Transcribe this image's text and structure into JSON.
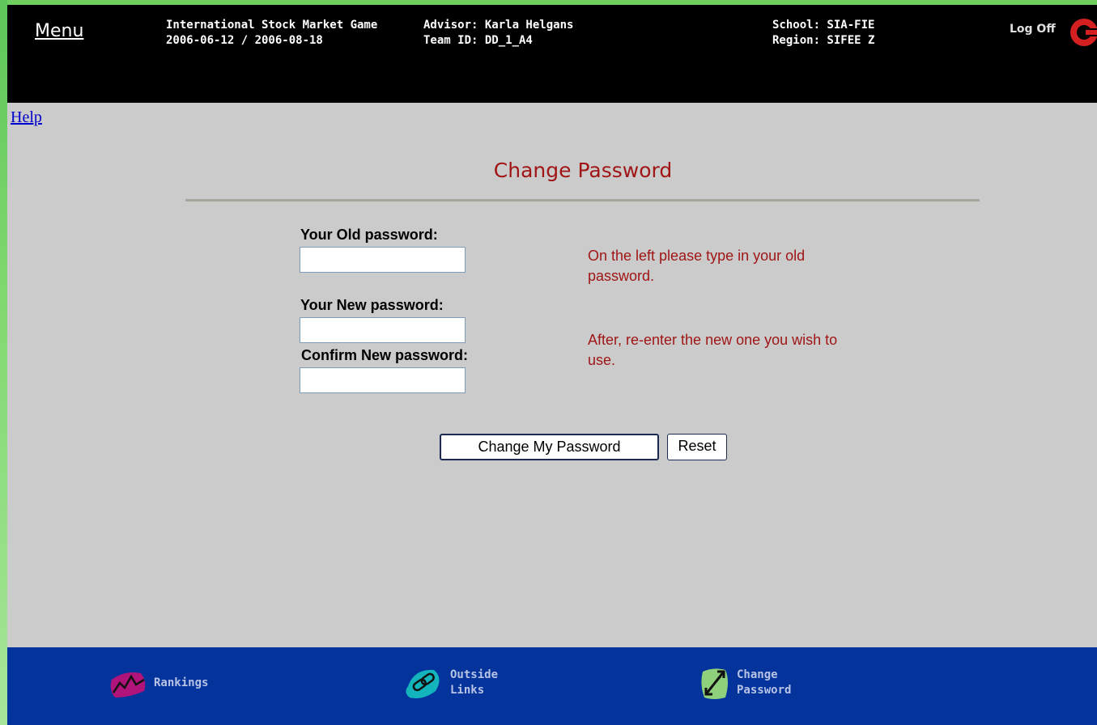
{
  "header": {
    "menu_label": "Menu",
    "game_name": "International Stock Market Game",
    "game_dates": "2006-06-12 / 2006-08-18",
    "advisor": "Advisor: Karla Helgans",
    "team_id": "Team ID: DD_1_A4",
    "school": "School: SIA-FIE",
    "region": "Region: SIFEE Z",
    "logoff_label": "Log Off",
    "logoff_icon": "logoff-icon"
  },
  "help_label": "Help",
  "form": {
    "title": "Change Password",
    "old_label": "Your Old password:",
    "old_value": "",
    "new_label": "Your New password:",
    "new_value": "",
    "confirm_label": "Confirm New password:",
    "confirm_value": "",
    "hint_old": "On the left please type in your old password.",
    "hint_new": "After, re-enter the new one you wish to use.",
    "submit_label": "Change My Password",
    "reset_label": "Reset"
  },
  "footer": {
    "items": [
      {
        "label": "Rankings",
        "icon": "rankings-icon"
      },
      {
        "label": "Outside\nLinks",
        "icon": "link-icon"
      },
      {
        "label": "Change\nPassword",
        "icon": "change-password-icon"
      }
    ]
  },
  "colors": {
    "header_bg": "#000000",
    "content_bg": "#cbcbcb",
    "accent_red": "#a01616",
    "footer_bg": "#04339c",
    "frame_green": "#6fcf5f"
  }
}
